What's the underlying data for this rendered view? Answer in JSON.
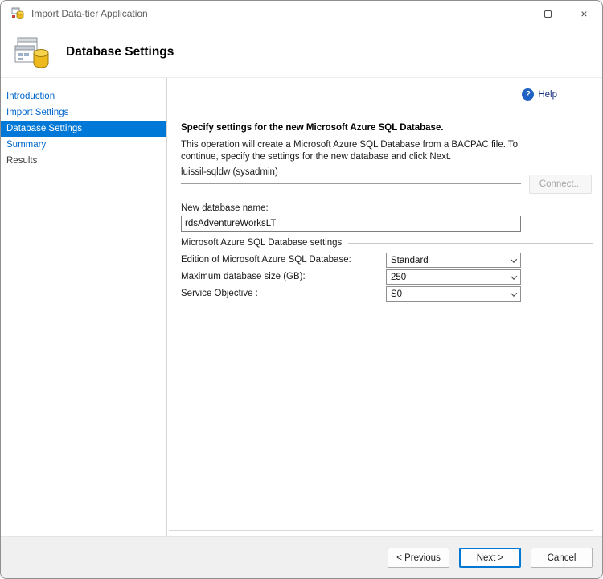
{
  "window": {
    "title": "Import Data-tier Application"
  },
  "header": {
    "title": "Database Settings"
  },
  "sidebar": {
    "items": [
      {
        "label": "Introduction",
        "state": "link"
      },
      {
        "label": "Import Settings",
        "state": "link"
      },
      {
        "label": "Database Settings",
        "state": "selected"
      },
      {
        "label": "Summary",
        "state": "link"
      },
      {
        "label": "Results",
        "state": "disabled"
      }
    ]
  },
  "main": {
    "help_label": "Help",
    "help_icon_glyph": "?",
    "heading": "Specify settings for the new Microsoft Azure SQL Database.",
    "description": "This operation will create a Microsoft Azure SQL Database from a BACPAC file. To continue, specify the settings for the new database and click Next.",
    "server": "luissil-sqldw (sysadmin)",
    "connect_button": "Connect...",
    "db_name_label": "New database name:",
    "db_name_value": "rdsAdventureWorksLT",
    "group_label": "Microsoft Azure SQL Database settings",
    "fields": [
      {
        "label": "Edition of Microsoft Azure SQL Database:",
        "value": "Standard"
      },
      {
        "label": "Maximum database size (GB):",
        "value": "250"
      },
      {
        "label": "Service Objective :",
        "value": "S0"
      }
    ]
  },
  "footer": {
    "previous": "< Previous",
    "next": "Next >",
    "cancel": "Cancel"
  },
  "colors": {
    "sidebar_selected": "#0078d7",
    "sidebar_link": "#0066cc",
    "help_text": "#15327c",
    "help_icon": "#2062c4",
    "next_focus_border": "#0078d4",
    "footer_bg": "#f0f0f0",
    "db_cylinder": "#edb91c"
  }
}
